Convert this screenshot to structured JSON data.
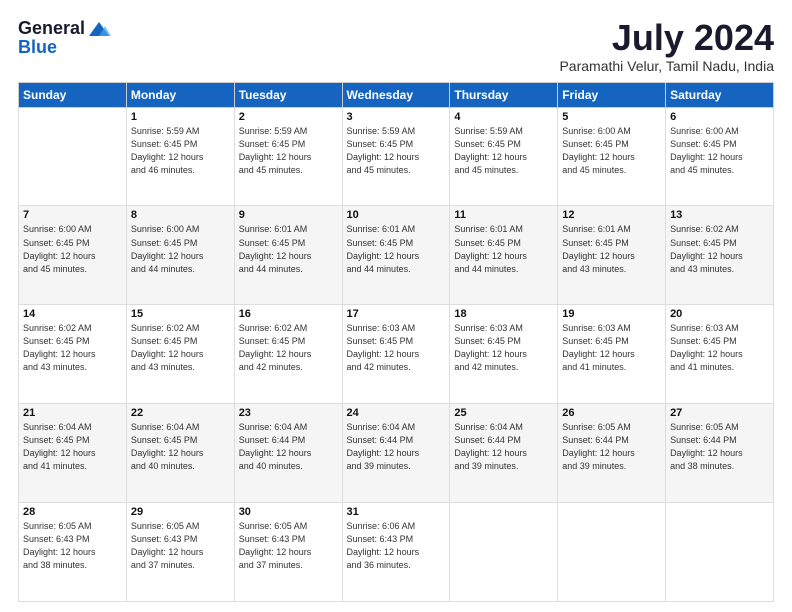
{
  "logo": {
    "general": "General",
    "blue": "Blue"
  },
  "title": "July 2024",
  "location": "Paramathi Velur, Tamil Nadu, India",
  "headers": [
    "Sunday",
    "Monday",
    "Tuesday",
    "Wednesday",
    "Thursday",
    "Friday",
    "Saturday"
  ],
  "weeks": [
    [
      {
        "day": "",
        "info": ""
      },
      {
        "day": "1",
        "info": "Sunrise: 5:59 AM\nSunset: 6:45 PM\nDaylight: 12 hours\nand 46 minutes."
      },
      {
        "day": "2",
        "info": "Sunrise: 5:59 AM\nSunset: 6:45 PM\nDaylight: 12 hours\nand 45 minutes."
      },
      {
        "day": "3",
        "info": "Sunrise: 5:59 AM\nSunset: 6:45 PM\nDaylight: 12 hours\nand 45 minutes."
      },
      {
        "day": "4",
        "info": "Sunrise: 5:59 AM\nSunset: 6:45 PM\nDaylight: 12 hours\nand 45 minutes."
      },
      {
        "day": "5",
        "info": "Sunrise: 6:00 AM\nSunset: 6:45 PM\nDaylight: 12 hours\nand 45 minutes."
      },
      {
        "day": "6",
        "info": "Sunrise: 6:00 AM\nSunset: 6:45 PM\nDaylight: 12 hours\nand 45 minutes."
      }
    ],
    [
      {
        "day": "7",
        "info": "Sunrise: 6:00 AM\nSunset: 6:45 PM\nDaylight: 12 hours\nand 45 minutes."
      },
      {
        "day": "8",
        "info": "Sunrise: 6:00 AM\nSunset: 6:45 PM\nDaylight: 12 hours\nand 44 minutes."
      },
      {
        "day": "9",
        "info": "Sunrise: 6:01 AM\nSunset: 6:45 PM\nDaylight: 12 hours\nand 44 minutes."
      },
      {
        "day": "10",
        "info": "Sunrise: 6:01 AM\nSunset: 6:45 PM\nDaylight: 12 hours\nand 44 minutes."
      },
      {
        "day": "11",
        "info": "Sunrise: 6:01 AM\nSunset: 6:45 PM\nDaylight: 12 hours\nand 44 minutes."
      },
      {
        "day": "12",
        "info": "Sunrise: 6:01 AM\nSunset: 6:45 PM\nDaylight: 12 hours\nand 43 minutes."
      },
      {
        "day": "13",
        "info": "Sunrise: 6:02 AM\nSunset: 6:45 PM\nDaylight: 12 hours\nand 43 minutes."
      }
    ],
    [
      {
        "day": "14",
        "info": "Sunrise: 6:02 AM\nSunset: 6:45 PM\nDaylight: 12 hours\nand 43 minutes."
      },
      {
        "day": "15",
        "info": "Sunrise: 6:02 AM\nSunset: 6:45 PM\nDaylight: 12 hours\nand 43 minutes."
      },
      {
        "day": "16",
        "info": "Sunrise: 6:02 AM\nSunset: 6:45 PM\nDaylight: 12 hours\nand 42 minutes."
      },
      {
        "day": "17",
        "info": "Sunrise: 6:03 AM\nSunset: 6:45 PM\nDaylight: 12 hours\nand 42 minutes."
      },
      {
        "day": "18",
        "info": "Sunrise: 6:03 AM\nSunset: 6:45 PM\nDaylight: 12 hours\nand 42 minutes."
      },
      {
        "day": "19",
        "info": "Sunrise: 6:03 AM\nSunset: 6:45 PM\nDaylight: 12 hours\nand 41 minutes."
      },
      {
        "day": "20",
        "info": "Sunrise: 6:03 AM\nSunset: 6:45 PM\nDaylight: 12 hours\nand 41 minutes."
      }
    ],
    [
      {
        "day": "21",
        "info": "Sunrise: 6:04 AM\nSunset: 6:45 PM\nDaylight: 12 hours\nand 41 minutes."
      },
      {
        "day": "22",
        "info": "Sunrise: 6:04 AM\nSunset: 6:45 PM\nDaylight: 12 hours\nand 40 minutes."
      },
      {
        "day": "23",
        "info": "Sunrise: 6:04 AM\nSunset: 6:44 PM\nDaylight: 12 hours\nand 40 minutes."
      },
      {
        "day": "24",
        "info": "Sunrise: 6:04 AM\nSunset: 6:44 PM\nDaylight: 12 hours\nand 39 minutes."
      },
      {
        "day": "25",
        "info": "Sunrise: 6:04 AM\nSunset: 6:44 PM\nDaylight: 12 hours\nand 39 minutes."
      },
      {
        "day": "26",
        "info": "Sunrise: 6:05 AM\nSunset: 6:44 PM\nDaylight: 12 hours\nand 39 minutes."
      },
      {
        "day": "27",
        "info": "Sunrise: 6:05 AM\nSunset: 6:44 PM\nDaylight: 12 hours\nand 38 minutes."
      }
    ],
    [
      {
        "day": "28",
        "info": "Sunrise: 6:05 AM\nSunset: 6:43 PM\nDaylight: 12 hours\nand 38 minutes."
      },
      {
        "day": "29",
        "info": "Sunrise: 6:05 AM\nSunset: 6:43 PM\nDaylight: 12 hours\nand 37 minutes."
      },
      {
        "day": "30",
        "info": "Sunrise: 6:05 AM\nSunset: 6:43 PM\nDaylight: 12 hours\nand 37 minutes."
      },
      {
        "day": "31",
        "info": "Sunrise: 6:06 AM\nSunset: 6:43 PM\nDaylight: 12 hours\nand 36 minutes."
      },
      {
        "day": "",
        "info": ""
      },
      {
        "day": "",
        "info": ""
      },
      {
        "day": "",
        "info": ""
      }
    ]
  ]
}
